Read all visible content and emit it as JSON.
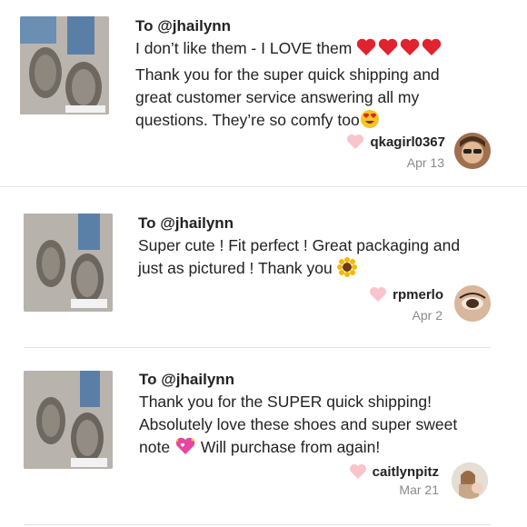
{
  "reviews": [
    {
      "to": "To @jhailynn",
      "lines": [
        "I don’t like them - I LOVE them",
        "Thank you for the super quick shipping and",
        "great customer service answering all my",
        "questions. They’re so comfy too"
      ],
      "username": "qkagirl0367",
      "date": "Apr 13",
      "emojis": [
        "red-heart-emoji",
        "red-heart-emoji",
        "red-heart-emoji",
        "red-heart-emoji",
        "heart-eyes-emoji"
      ]
    },
    {
      "to": "To @jhailynn",
      "lines": [
        "Super cute ! Fit perfect ! Great packaging and",
        "just as pictured ! Thank you"
      ],
      "username": "rpmerlo",
      "date": "Apr 2",
      "emojis": [
        "sunflower-emoji"
      ]
    },
    {
      "to": "To @jhailynn",
      "lines": [
        "Thank you for the SUPER quick shipping!",
        "Absolutely love these shoes and super sweet",
        "note",
        "Will purchase from again!"
      ],
      "username": "caitlynpitz",
      "date": "Mar 21",
      "emojis": [
        "sparkling-heart-emoji"
      ]
    }
  ],
  "colors": {
    "heart_outline": "#f9c4cc",
    "date": "#8a8a8a",
    "divider": "#e3e3e3",
    "emoji_red": "#e0232f"
  }
}
